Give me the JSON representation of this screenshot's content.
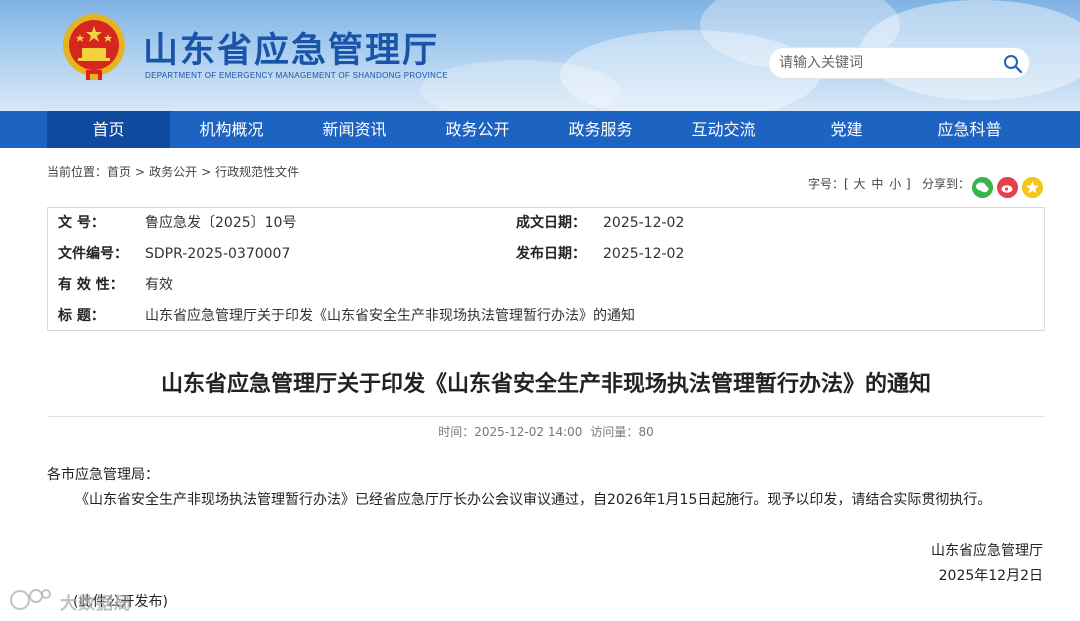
{
  "header": {
    "site_title": "山东省应急管理厅",
    "site_subtitle": "DEPARTMENT OF EMERGENCY MANAGEMENT OF SHANDONG PROVINCE",
    "search_placeholder": "请输入关键词",
    "emblem_icon": "national-emblem-icon",
    "search_icon": "search-icon"
  },
  "nav": {
    "items": [
      {
        "label": "首页"
      },
      {
        "label": "机构概况"
      },
      {
        "label": "新闻资讯"
      },
      {
        "label": "政务公开"
      },
      {
        "label": "政务服务"
      },
      {
        "label": "互动交流"
      },
      {
        "label": "党建"
      },
      {
        "label": "应急科普"
      }
    ],
    "active": "首页",
    "color": "#1d63c2",
    "active_color": "#0f4a9e"
  },
  "breadcrumb": {
    "prefix": "当前位置：",
    "items": [
      "首页",
      "政务公开",
      "行政规范性文件"
    ],
    "separator": ">"
  },
  "tools": {
    "font_size_label": "字号：",
    "sizes": [
      "大",
      "中",
      "小"
    ],
    "share_label": "分享到：",
    "share_icons": [
      "wechat-icon",
      "weibo-icon",
      "favorite-icon"
    ]
  },
  "meta": {
    "doc_number_label": "文 号：",
    "doc_number": "鲁应急发〔2025〕10号",
    "created_label": "成文日期：",
    "created": "2025-12-02",
    "file_code_label": "文件编号：",
    "file_code": "SDPR-2025-0370007",
    "published_label": "发布日期：",
    "published": "2025-12-02",
    "validity_label": "有 效 性：",
    "validity": "有效",
    "title_label": "标 题：",
    "title": "山东省应急管理厅关于印发《山东省安全生产非现场执法管理暂行办法》的通知"
  },
  "article": {
    "title": "山东省应急管理厅关于印发《山东省安全生产非现场执法管理暂行办法》的通知",
    "time_label": "时间：",
    "time": "2025-12-02 14:00",
    "views_label": "访问量：",
    "views": "80",
    "salutation": "各市应急管理局：",
    "body": "《山东省安全生产非现场执法管理暂行办法》已经省应急厅厅长办公会议审议通过，自2026年1月15日起施行。现予以印发，请结合实际贯彻执行。",
    "sign_org": "山东省应急管理厅",
    "sign_date": "2025年12月2日",
    "release_note": "(此件公开发布)"
  },
  "watermark": {
    "text": "大数据局",
    "icon": "watermark-logo-icon"
  }
}
